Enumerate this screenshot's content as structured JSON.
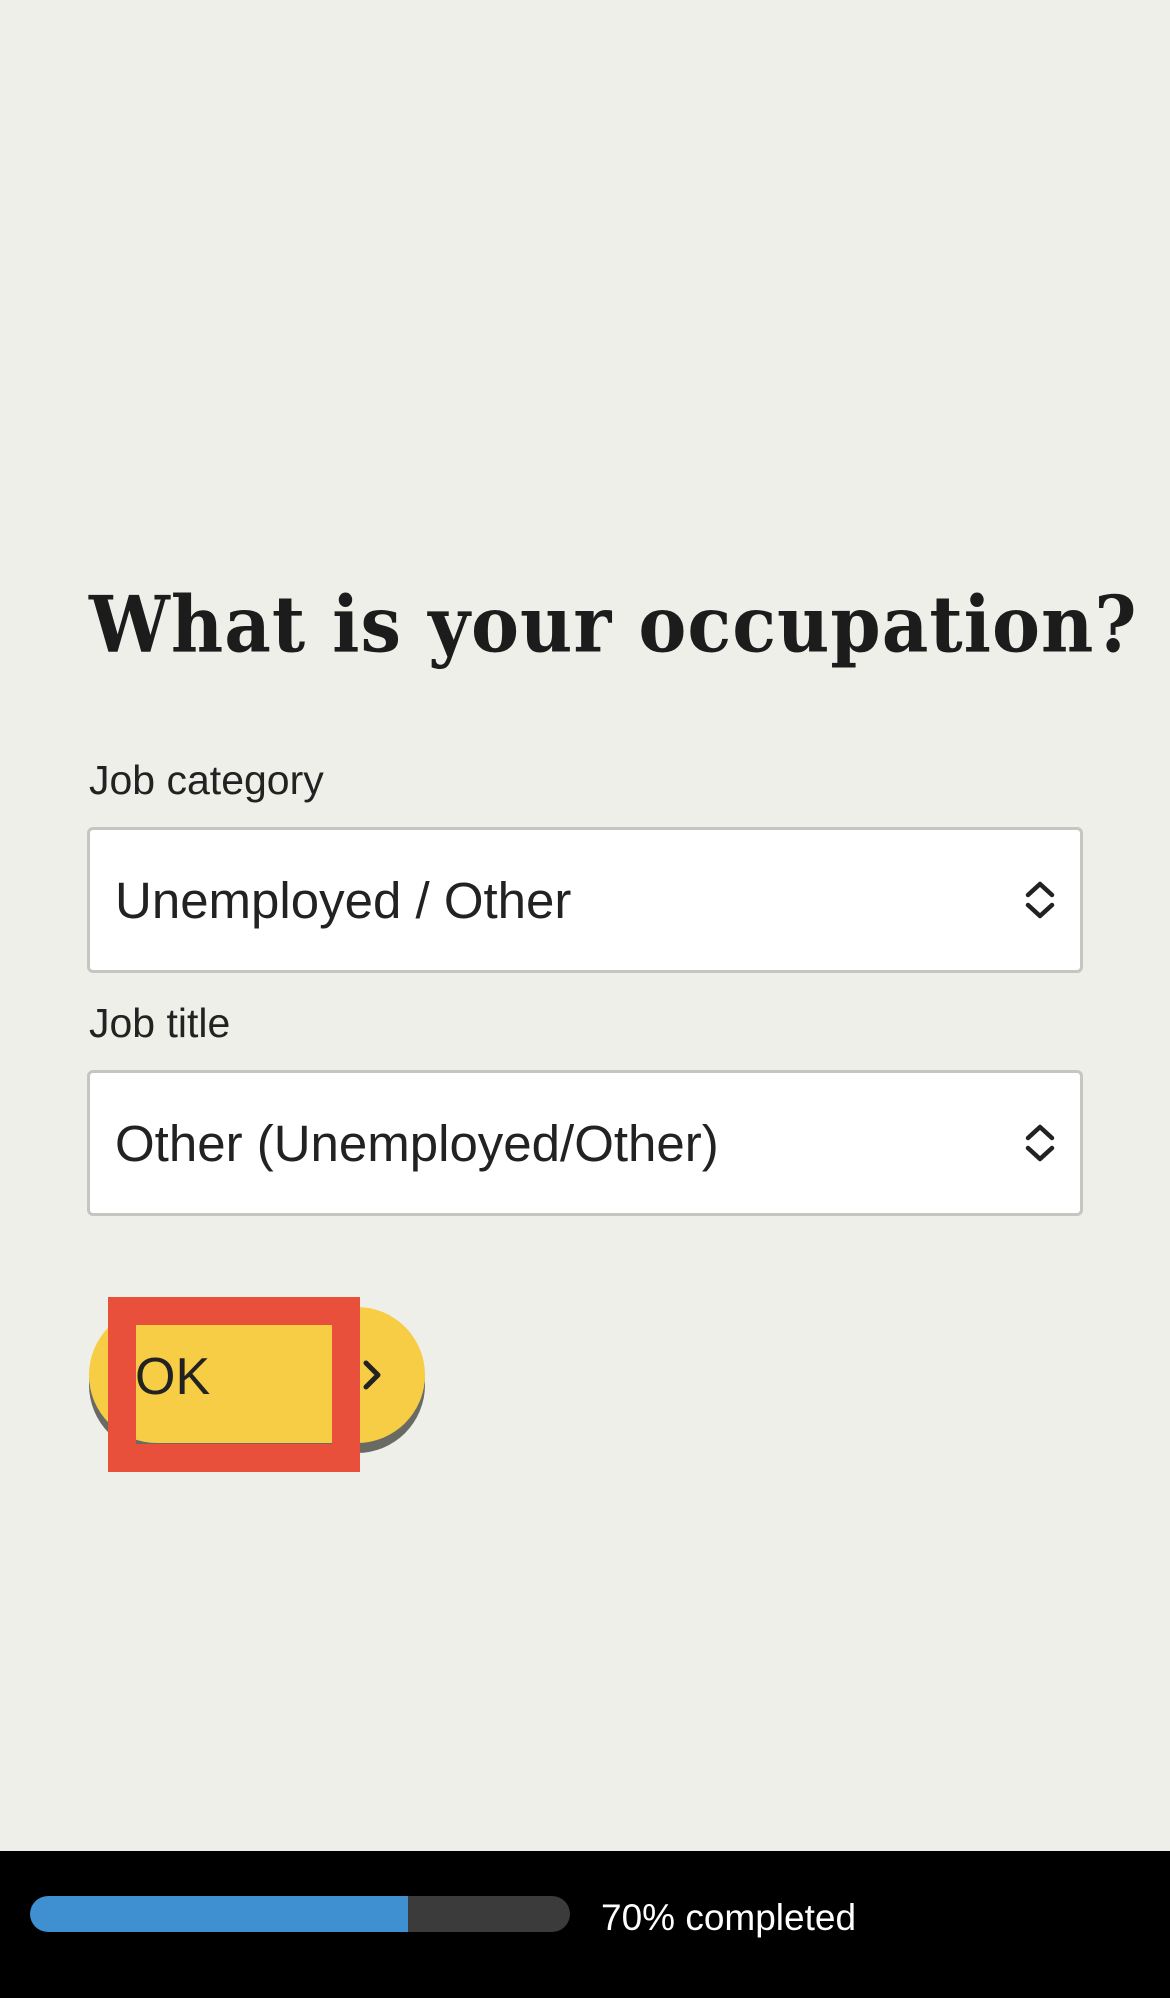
{
  "question": {
    "title": "What is your occupation?"
  },
  "job_category": {
    "label": "Job category",
    "selected": "Unemployed / Other"
  },
  "job_title": {
    "label": "Job title",
    "selected": "Other (Unemployed/Other)"
  },
  "submit": {
    "label": "OK",
    "icon": "chevron-right-icon",
    "color": "#f6cd45"
  },
  "annotation": {
    "color": "#e8503b"
  },
  "progress": {
    "percent": 70,
    "text": "70% completed",
    "fill_color": "#3f90d0"
  }
}
